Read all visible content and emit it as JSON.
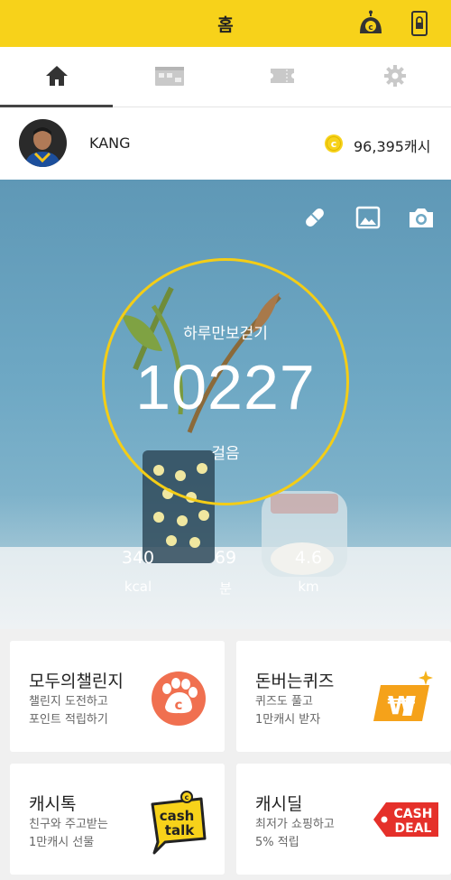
{
  "header": {
    "title": "홈",
    "cashbot_icon": "cashbot-icon",
    "lock_icon": "lock-phone-icon",
    "accent": "#f7d21a"
  },
  "tabs": [
    {
      "icon": "home-icon",
      "active": true
    },
    {
      "icon": "calendar-icon",
      "active": false
    },
    {
      "icon": "ticket-icon",
      "active": false
    },
    {
      "icon": "gear-icon",
      "active": false
    }
  ],
  "profile": {
    "name": "KANG",
    "cash": "96,395캐시",
    "coin_icon": "coin-icon"
  },
  "hero": {
    "tools": [
      "pill-icon",
      "image-icon",
      "camera-icon"
    ],
    "title": "하루만보걷기",
    "steps": "10227",
    "steps_unit": "걸음",
    "stats": [
      {
        "value": "340",
        "unit": "kcal"
      },
      {
        "value": "69",
        "unit": "분"
      },
      {
        "value": "4.6",
        "unit": "km"
      }
    ],
    "ring_color": "#f4cd16"
  },
  "cards": [
    {
      "title": "모두의챌린지",
      "desc1": "챌린지 도전하고",
      "desc2": "포인트 적립하기",
      "icon": "paw-coin-icon"
    },
    {
      "title": "돈버는퀴즈",
      "desc1": "퀴즈도 풀고",
      "desc2": "1만캐시 받자",
      "icon": "won-quiz-icon"
    },
    {
      "title": "캐시톡",
      "desc1": "친구와 주고받는",
      "desc2": "1만캐시 선물",
      "icon": "cash-talk-icon",
      "logo_text1": "cash",
      "logo_text2": "talk"
    },
    {
      "title": "캐시딜",
      "desc1": "최저가 쇼핑하고",
      "desc2": "5% 적립",
      "icon": "cash-deal-icon",
      "logo_text1": "CASH",
      "logo_text2": "DEAL"
    }
  ]
}
